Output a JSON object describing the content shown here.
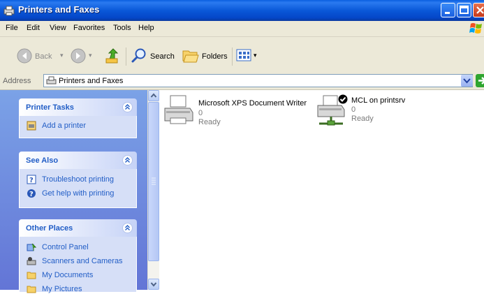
{
  "window": {
    "title": "Printers and Faxes"
  },
  "menu": {
    "items": [
      "File",
      "Edit",
      "View",
      "Favorites",
      "Tools",
      "Help"
    ]
  },
  "toolbar": {
    "back": "Back",
    "search": "Search",
    "folders": "Folders"
  },
  "address": {
    "label": "Address",
    "value": "Printers and Faxes",
    "go": "Go"
  },
  "panels": {
    "printer_tasks": {
      "title": "Printer Tasks",
      "items": [
        "Add a printer"
      ]
    },
    "see_also": {
      "title": "See Also",
      "items": [
        "Troubleshoot printing",
        "Get help with printing"
      ]
    },
    "other_places": {
      "title": "Other Places",
      "items": [
        "Control Panel",
        "Scanners and Cameras",
        "My Documents",
        "My Pictures"
      ]
    }
  },
  "printers": [
    {
      "name": "Microsoft XPS Document Writer",
      "count": "0",
      "status": "Ready",
      "default": false,
      "shared": false
    },
    {
      "name": "MCL on printsrv",
      "count": "0",
      "status": "Ready",
      "default": true,
      "shared": true
    }
  ],
  "colors": {
    "titlebar": "#0a58d8",
    "pane": "#6f8ddf",
    "link": "#215dc6"
  }
}
